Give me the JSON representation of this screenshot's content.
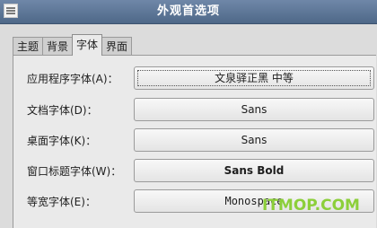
{
  "window": {
    "title": "外观首选项"
  },
  "tabs": [
    {
      "label": "主题"
    },
    {
      "label": "背景"
    },
    {
      "label": "字体"
    },
    {
      "label": "界面"
    }
  ],
  "fonts": {
    "rows": [
      {
        "label": "应用程序字体(A)：",
        "value": "文泉驿正黑 中等"
      },
      {
        "label": "文档字体(D)：",
        "value": "Sans"
      },
      {
        "label": "桌面字体(K)：",
        "value": "Sans"
      },
      {
        "label": "窗口标题字体(W)：",
        "value": "Sans Bold"
      },
      {
        "label": "等宽字体(E)：",
        "value": "Monospace"
      }
    ]
  },
  "watermark": {
    "text": "ITMOP.COM"
  }
}
